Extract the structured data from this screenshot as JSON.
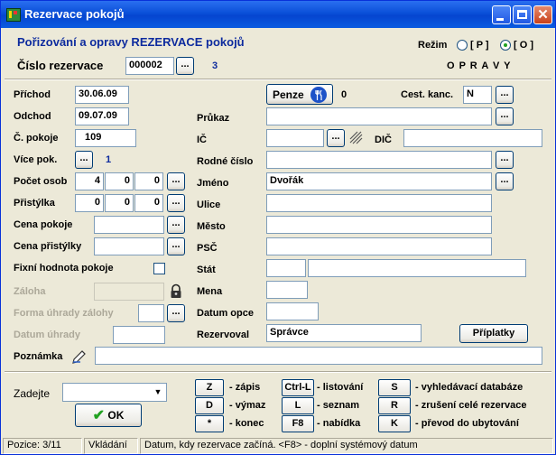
{
  "window": {
    "title": "Rezervace pokojů"
  },
  "header": {
    "subtitle": "Pořizování a opravy REZERVACE pokojů",
    "cislo_label": "Číslo rezervace",
    "cislo_value": "000002",
    "cislo_count": "3",
    "rezim_label": "Režim",
    "rezim_p": "[ P ]",
    "rezim_o": "[ O ]",
    "rezim_selected": "O",
    "mode_text": "O P R A V Y"
  },
  "left": {
    "prichod_label": "Příchod",
    "prichod": "30.06.09",
    "odchod_label": "Odchod",
    "odchod": "09.07.09",
    "pokoj_label": "Č. pokoje",
    "pokoj": "109",
    "vice_label": "Více pok.",
    "vice_count": "1",
    "osob_label": "Počet osob",
    "osob": [
      "4",
      "0",
      "0"
    ],
    "pristylka_label": "Přistýlka",
    "pristylka": [
      "0",
      "0",
      "0"
    ],
    "cena_pokoje_label": "Cena pokoje",
    "cena_pokoje": "",
    "cena_pristylky_label": "Cena přistýlky",
    "cena_pristylky": "",
    "fixni_label": "Fixní hodnota pokoje",
    "zaloha_label": "Záloha",
    "zaloha": "",
    "forma_label": "Forma úhrady zálohy",
    "forma": "",
    "datum_uhrady_label": "Datum úhrady",
    "datum_uhrady": "",
    "poznamka_label": "Poznámka",
    "poznamka": ""
  },
  "right": {
    "penze_label": "Penze",
    "penze_count": "0",
    "cest_label": "Cest. kanc.",
    "cest": "N",
    "prukaz_label": "Průkaz",
    "prukaz": "",
    "ic_label": "IČ",
    "ic": "",
    "dic_label": "DIČ",
    "dic": "",
    "rodne_label": "Rodné číslo",
    "rodne": "",
    "jmeno_label": "Jméno",
    "jmeno": "Dvořák",
    "ulice_label": "Ulice",
    "ulice": "",
    "mesto_label": "Město",
    "mesto": "",
    "psc_label": "PSČ",
    "psc": "",
    "stat_label": "Stát",
    "stat_code": "",
    "stat_name": "",
    "mena_label": "Mena",
    "mena": "",
    "datum_opce_label": "Datum opce",
    "datum_opce": "",
    "rezervoval_label": "Rezervoval",
    "rezervoval": "Správce",
    "priplatky_label": "Příplatky"
  },
  "bottom": {
    "zadejte_label": "Zadejte",
    "zadejte_value": "",
    "ok_label": "OK",
    "keys": [
      {
        "key": "Z",
        "desc": "- zápis"
      },
      {
        "key": "D",
        "desc": "- výmaz"
      },
      {
        "key": "*",
        "desc": "- konec"
      },
      {
        "key": "Ctrl-L",
        "desc": "- listování"
      },
      {
        "key": "L",
        "desc": "- seznam"
      },
      {
        "key": "F8",
        "desc": "- nabídka"
      },
      {
        "key": "S",
        "desc": "- vyhledávací databáze"
      },
      {
        "key": "R",
        "desc": "- zrušení celé rezervace"
      },
      {
        "key": "K",
        "desc": "- převod do ubytování"
      }
    ]
  },
  "status": {
    "pozice": "Pozice: 3/11",
    "mode": "Vkládání",
    "hint": "Datum, kdy rezervace začíná. <F8> - doplní systémový datum"
  },
  "colors": {
    "accent": "#0d2b9e",
    "titlebar": "#0a4fd8",
    "ok_check": "#21a121"
  },
  "icons": [
    "app-icon",
    "fork-knife-icon",
    "lock-icon",
    "hatch-icon",
    "pen-icon",
    "check-icon",
    "dropdown-arrow-icon"
  ]
}
